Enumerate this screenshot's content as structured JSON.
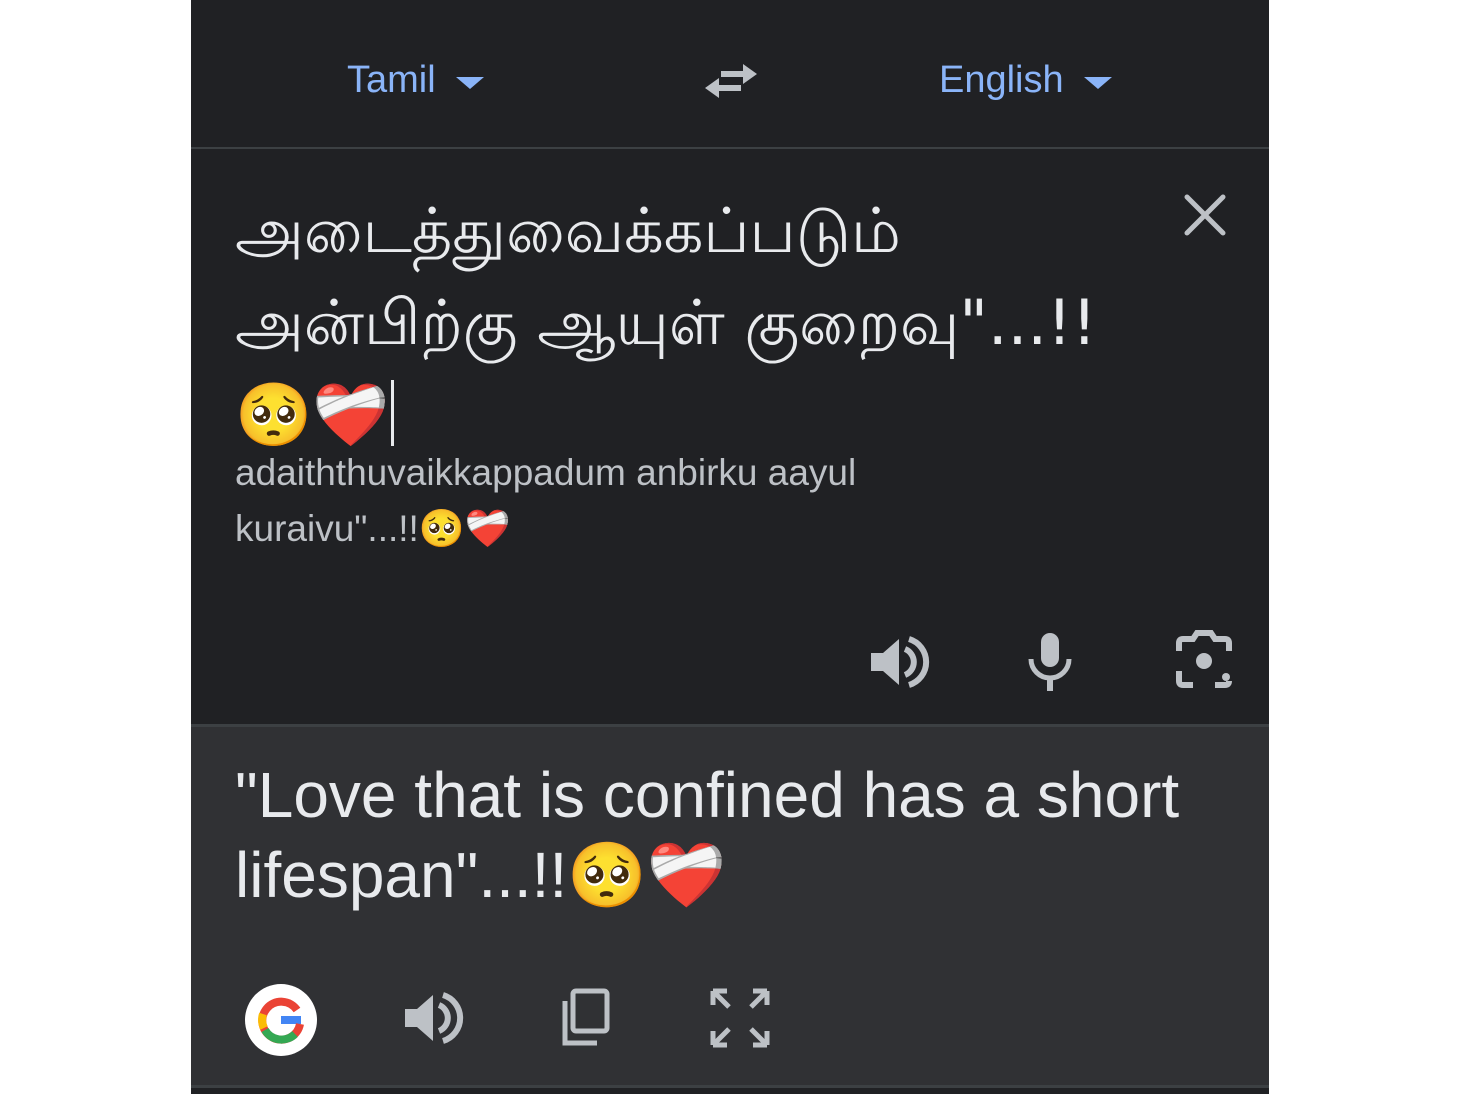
{
  "header": {
    "source_language": "Tamil",
    "target_language": "English",
    "swap_icon": "swap-arrows-icon"
  },
  "source": {
    "text": "அடைத்துவைக்கப்படும் அன்பிற்கு ஆயுள் குறைவு\"...!!🥺❤️‍🩹",
    "transliteration": "adaiththuvaikkappadum anbirku aayul kuraivu\"...!!🥺❤️‍🩹",
    "tools": [
      "speaker-icon",
      "microphone-icon",
      "camera-icon"
    ]
  },
  "result": {
    "text": "\"Love that is confined has a short lifespan\"...!!🥺❤️‍🩹",
    "tools": [
      "google-logo",
      "speaker-icon",
      "copy-icon",
      "fullscreen-icon"
    ]
  },
  "colors": {
    "background": "#202124",
    "result_background": "#303134",
    "accent": "#8ab4f8",
    "text": "#e8eaed",
    "icon": "#bdc1c6"
  }
}
